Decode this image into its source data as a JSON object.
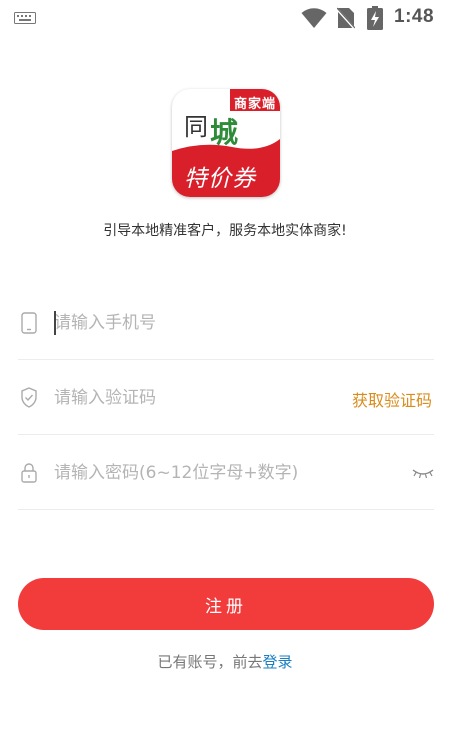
{
  "status_bar": {
    "time": "1:48",
    "icons": [
      "keyboard-icon",
      "wifi-icon",
      "no-sim-icon",
      "battery-charging-icon"
    ]
  },
  "logo": {
    "badge_text": "商家端",
    "line1_a": "同",
    "line1_b": "城",
    "line2": "特价券",
    "colors": {
      "red": "#d81f2a",
      "green": "#2e8b3a"
    }
  },
  "tagline": "引导本地精准客户，服务本地实体商家!",
  "form": {
    "phone": {
      "placeholder": "请输入手机号",
      "value": "",
      "icon": "phone-icon"
    },
    "code": {
      "placeholder": "请输入验证码",
      "value": "",
      "icon": "shield-icon",
      "action_label": "获取验证码"
    },
    "password": {
      "placeholder": "请输入密码(6~12位字母+数字)",
      "value": "",
      "icon": "lock-icon",
      "toggle_icon": "eye-closed-icon"
    }
  },
  "register_button": {
    "label": "注册"
  },
  "footer": {
    "prefix": "已有账号，前去",
    "link": "登录"
  },
  "colors": {
    "primary": "#f23b3b",
    "accent_orange": "#d98c1c",
    "link_blue": "#1a7fc1"
  }
}
